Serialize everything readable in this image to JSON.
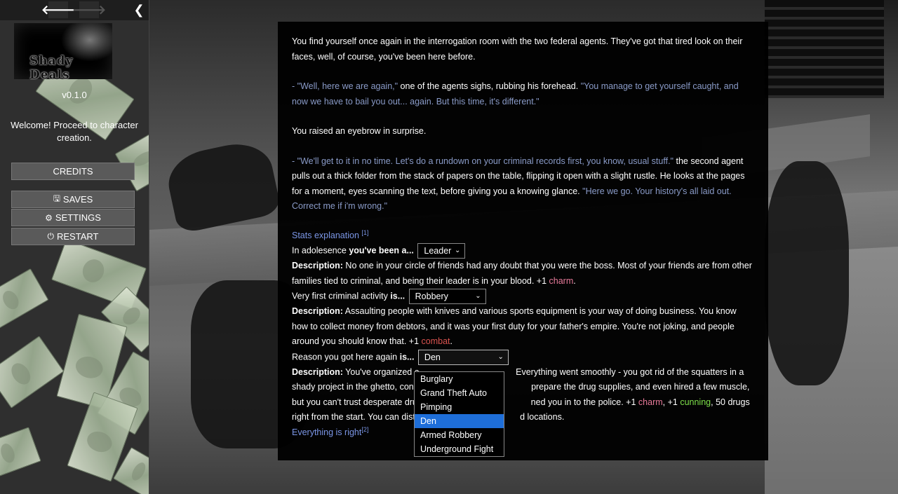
{
  "nav": {
    "back_icon": "arrow-left-icon",
    "forward_icon": "arrow-right-icon",
    "collapse_icon": "chevron-left-icon"
  },
  "sidebar": {
    "logo_text": "Shady Deals",
    "version": "v0.1.0",
    "welcome": "Welcome! Proceed to character creation.",
    "credits": "CREDITS",
    "saves": "SAVES",
    "settings": "SETTINGS",
    "restart": "RESTART"
  },
  "passage": {
    "p1": "You find yourself once again in the interrogation room with the two federal agents. They've got that tired look on their faces, well, of course, you've been here before.",
    "p2_speech_a": "- \"Well, here we are again,\"",
    "p2_text": " one of the agents sighs, rubbing his forehead. ",
    "p2_speech_b": "\"You manage to get yourself caught, and now we have to bail you out... again. But this time, it's different.\"",
    "p3": "You raised an eyebrow in surprise.",
    "p4_speech_a": "- \"We'll get to it in no time. Let's do a rundown on your criminal records first, you know, usual stuff.\"",
    "p4_text": " the second agent pulls out a thick folder from the stack of papers on the table, flipping it open with a slight rustle. He looks at the pages for a moment, eyes scanning the text, before giving you a knowing glance. ",
    "p4_speech_b": "\"Here we go. Your history's all laid out. Correct me if i'm wrong.\"",
    "stats_link": "Stats explanation",
    "stats_sup": "[1]",
    "q1_prefix": "In adolesence ",
    "q1_bold": "you've been a...",
    "q1_value": "Leader",
    "desc_label": "Description:",
    "d1_text": " No one in your circle of friends had any doubt that you were the boss. Most of your friends are from other families tied to criminal, and being their leader is in your blood. +1 ",
    "d1_stat": "charm",
    "q2_prefix": "Very first criminal activity ",
    "q2_bold": "is...",
    "q2_value": "Robbery",
    "d2_text": " Assaulting people with knives and various sports equipment is your way of doing business. You know how to collect money from debtors, and it was your first duty for your father's empire. You're not joking, and people around you should know that. +1 ",
    "d2_stat": "combat",
    "q3_prefix": "Reason you got here again ",
    "q3_bold": "is...",
    "q3_value": "Den",
    "d3_a": " You've organized a",
    "d3_b": " Everything went smoothly - you got rid of the squatters in a shady project in the ghetto, convinced s",
    "d3_c": " prepare the drug supplies, and even hired a few muscle, but you can't trust desperate drug addict",
    "d3_d": "ned you in to the police. +1 ",
    "d3_stat1": "charm",
    "d3_sep": ", +1 ",
    "d3_stat2": "cunning",
    "d3_e": ", 50 drugs right from the start. You can distribute",
    "d3_f": "d locations.",
    "everything_link": "Everything is right",
    "everything_sup": "[2]"
  },
  "dropdown_options": [
    "Burglary",
    "Grand Theft Auto",
    "Pimping",
    "Den",
    "Armed Robbery",
    "Underground Fight"
  ],
  "dropdown_selected": "Den",
  "colors": {
    "speech": "#8a9bc8",
    "link": "#7b96e6",
    "charm": "#e87a9a",
    "combat": "#d9534f",
    "cunning": "#7ee04a",
    "selected": "#1e6ed8"
  }
}
